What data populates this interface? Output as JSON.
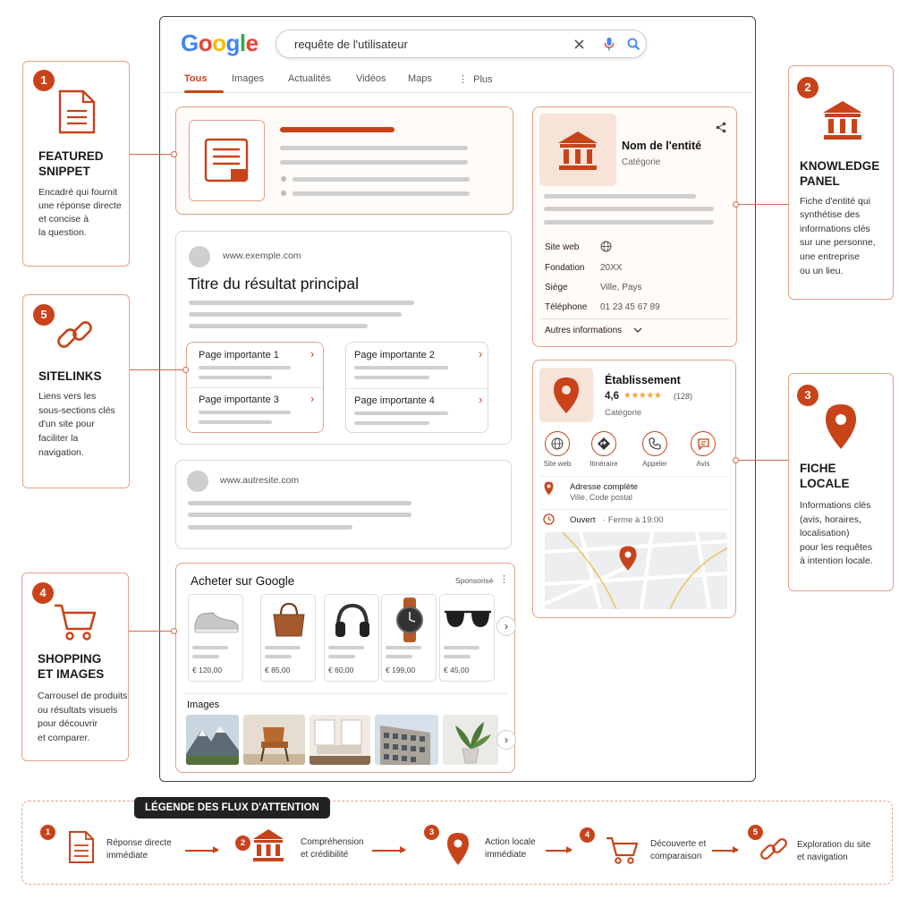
{
  "browser": {
    "logo": "Google",
    "search": {
      "value": "requête de l'utilisateur"
    },
    "tabs": [
      {
        "label": "Tous"
      },
      {
        "label": "Images"
      },
      {
        "label": "Actualités"
      },
      {
        "label": "Vidéos"
      },
      {
        "label": "Maps"
      },
      {
        "label": "Plus"
      }
    ]
  },
  "main_result": {
    "url": "www.exemple.com",
    "title": "Titre du résultat principal",
    "sitelinks": [
      {
        "label": "Page importante 1"
      },
      {
        "label": "Page importante 2"
      },
      {
        "label": "Page importante 3"
      },
      {
        "label": "Page importante 4"
      }
    ]
  },
  "second_result": {
    "url": "www.autresite.com"
  },
  "shopping": {
    "title": "Acheter sur Google",
    "sponsored": "Sponsorisé",
    "products": [
      {
        "icon": "sneaker-icon",
        "price": "€ 120,00"
      },
      {
        "icon": "handbag-icon",
        "price": "€ 85,00"
      },
      {
        "icon": "headphones-icon",
        "price": "€ 60,00"
      },
      {
        "icon": "watch-icon",
        "price": "€ 199,00"
      },
      {
        "icon": "sunglasses-icon",
        "price": "€ 45,00"
      }
    ],
    "images_label": "Images",
    "images": [
      {
        "icon": "mountain-photo"
      },
      {
        "icon": "chair-photo"
      },
      {
        "icon": "living-room-photo"
      },
      {
        "icon": "building-photo"
      },
      {
        "icon": "plant-photo"
      }
    ]
  },
  "knowledge_panel": {
    "entity_name": "Nom de l'entité",
    "category": "Catégorie",
    "rows": [
      {
        "label": "Site web",
        "value": ""
      },
      {
        "label": "Fondation",
        "value": "20XX"
      },
      {
        "label": "Siège",
        "value": "Ville, Pays"
      },
      {
        "label": "Téléphone",
        "value": "01 23 45 67 89"
      }
    ],
    "more": "Autres informations"
  },
  "local": {
    "name": "Établissement",
    "rating": "4,6",
    "stars": "★★★★★",
    "reviews": "(128)",
    "category": "Catégorie",
    "actions": [
      {
        "label": "Site web"
      },
      {
        "label": "Itinéraire"
      },
      {
        "label": "Appeler"
      },
      {
        "label": "Avis"
      }
    ],
    "address_title": "Adresse complète",
    "address_sub": "Ville, Code postal",
    "open": "Ouvert",
    "close_time": "· Ferme à 19:00"
  },
  "annotations": [
    {
      "num": "1",
      "title_1": "FEATURED",
      "title_2": "SNIPPET",
      "desc": [
        "Encadré qui fournit",
        "une réponse directe",
        "et concise à",
        "la question."
      ]
    },
    {
      "num": "2",
      "title_1": "KNOWLEDGE",
      "title_2": "PANEL",
      "desc": [
        "Fiche d'entité qui",
        "synthétise des",
        "informations clés",
        "sur une personne,",
        "une entreprise",
        "ou un lieu."
      ]
    },
    {
      "num": "3",
      "title_1": "FICHE",
      "title_2": "LOCALE",
      "desc": [
        "Informations clés",
        "(avis, horaires,",
        "localisation)",
        "pour les requêtes",
        "à intention locale."
      ]
    },
    {
      "num": "4",
      "title_1": "SHOPPING",
      "title_2": "ET IMAGES",
      "desc": [
        "Carrousel de produits",
        "ou résultats visuels",
        "pour découvrir",
        "et comparer."
      ]
    },
    {
      "num": "5",
      "title_1": "SITELINKS",
      "title_2": "",
      "desc": [
        "Liens vers les",
        "sous-sections clés",
        "d'un site pour",
        "faciliter la",
        "navigation."
      ]
    }
  ],
  "legend": {
    "title": "LÉGENDE DES FLUX D'ATTENTION",
    "steps": [
      {
        "num": "1",
        "line1": "Réponse directe",
        "line2": "immédiate"
      },
      {
        "num": "2",
        "line1": "Compréhension",
        "line2": "et crédibilité"
      },
      {
        "num": "3",
        "line1": "Action locale",
        "line2": "immédiate"
      },
      {
        "num": "4",
        "line1": "Découverte et",
        "line2": "comparaison"
      },
      {
        "num": "5",
        "line1": "Exploration du site",
        "line2": "et navigation"
      }
    ]
  },
  "colors": {
    "accent": "#c8431a",
    "accent_light": "#e2a288",
    "star": "#e8a93a"
  }
}
